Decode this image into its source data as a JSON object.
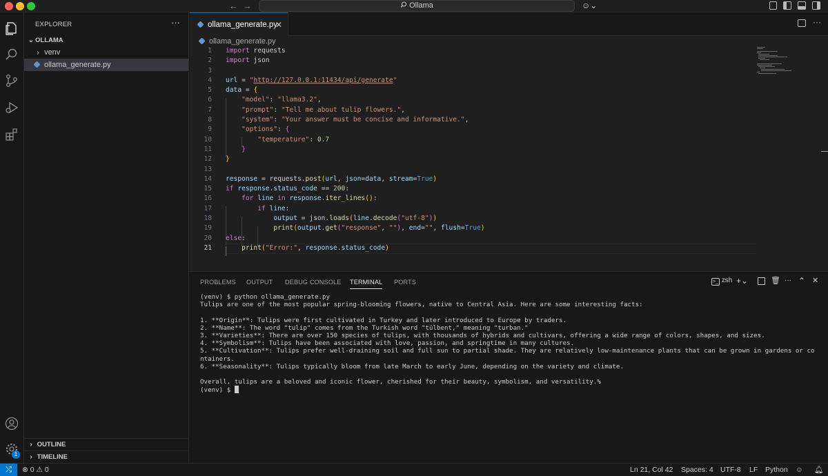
{
  "titlebar": {
    "search_text": "Ollama",
    "search_icon": "search-icon"
  },
  "sidebar": {
    "header": "EXPLORER",
    "folder": "OLLAMA",
    "items": [
      {
        "label": "venv",
        "type": "folder"
      },
      {
        "label": "ollama_generate.py",
        "type": "file"
      }
    ],
    "outline": "OUTLINE",
    "timeline": "TIMELINE"
  },
  "editor": {
    "tab": "ollama_generate.py",
    "breadcrumb": "ollama_generate.py",
    "active_line": 21
  },
  "code_lines": [
    "import requests",
    "import json",
    "",
    "url = \"http://127.0.0.1:11434/api/generate\"",
    "data = {",
    "    \"model\": \"llama3.2\",",
    "    \"prompt\": \"Tell me about tulip flowers.\",",
    "    \"system\": \"Your answer must be concise and informative.\",",
    "    \"options\": {",
    "        \"temperature\": 0.7",
    "    }",
    "}",
    "",
    "response = requests.post(url, json=data, stream=True)",
    "if response.status_code == 200:",
    "    for line in response.iter_lines():",
    "        if line:",
    "            output = json.loads(line.decode(\"utf-8\"))",
    "            print(output.get(\"response\", \"\"), end=\"\", flush=True)",
    "else:",
    "    print(\"Error:\", response.status_code)"
  ],
  "panel": {
    "tabs": [
      "PROBLEMS",
      "OUTPUT",
      "DEBUG CONSOLE",
      "TERMINAL",
      "PORTS"
    ],
    "active_tab": "TERMINAL",
    "shell": "zsh"
  },
  "terminal_lines": [
    "(venv) $ python ollama_generate.py",
    "Tulips are one of the most popular spring-blooming flowers, native to Central Asia. Here are some interesting facts:",
    "",
    "1. **Origin**: Tulips were first cultivated in Turkey and later introduced to Europe by traders.",
    "2. **Name**: The word \"tulip\" comes from the Turkish word \"tülbent,\" meaning \"turban.\"",
    "3. **Varieties**: There are over 150 species of tulips, with thousands of hybrids and cultivars, offering a wide range of colors, shapes, and sizes.",
    "4. **Symbolism**: Tulips have been associated with love, passion, and springtime in many cultures.",
    "5. **Cultivation**: Tulips prefer well-draining soil and full sun to partial shade. They are relatively low-maintenance plants that can be grown in gardens or co",
    "ntainers.",
    "6. **Seasonality**: Tulips typically bloom from late March to early June, depending on the variety and climate.",
    "",
    "Overall, tulips are a beloved and iconic flower, cherished for their beauty, symbolism, and versatility.%",
    "(venv) $ "
  ],
  "statusbar": {
    "errors": "0",
    "warnings": "0",
    "position": "Ln 21, Col 42",
    "spaces": "Spaces: 4",
    "encoding": "UTF-8",
    "eol": "LF",
    "language": "Python",
    "accounts_badge": "1"
  }
}
